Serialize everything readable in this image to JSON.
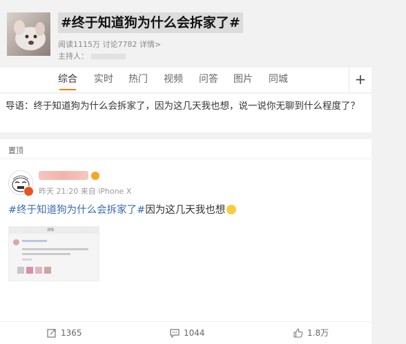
{
  "topic": {
    "title": "#终于知道狗为什么会拆家了#",
    "stats": "阅读1115万 讨论7782 详情>",
    "host_label": "主持人："
  },
  "tabs": [
    "综合",
    "实时",
    "热门",
    "视频",
    "问答",
    "图片",
    "同城"
  ],
  "active_tab": "综合",
  "add_symbol": "+",
  "intro": {
    "text": "导语：终于知道狗为什么会拆家了，因为这几天我也想，说一说你无聊到什么程度了？"
  },
  "post": {
    "pinned_label": "置顶",
    "meta": "昨天 21:20 来自 iPhone X",
    "hashtag": "#终于知道狗为什么会拆家了#",
    "text": "因为这几天我也想",
    "image_title": "详情"
  },
  "actions": {
    "repost": "1365",
    "comment": "1044",
    "like": "1.8万"
  },
  "colors": {
    "accent": "#f08300",
    "hashtag": "#3b6bb3"
  }
}
